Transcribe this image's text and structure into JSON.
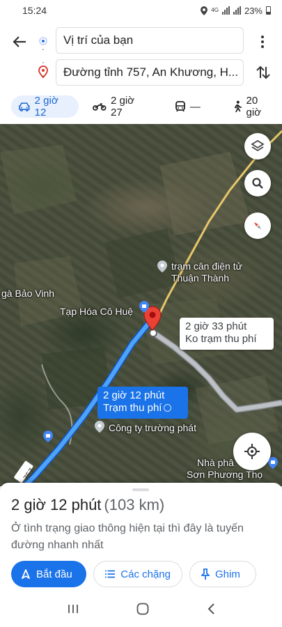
{
  "status_bar": {
    "time": "15:24",
    "network": "4G",
    "battery": "23%"
  },
  "route": {
    "origin": "Vị trí của bạn",
    "destination": "Đường tỉnh 757, An Khương, H..."
  },
  "modes": [
    {
      "name": "car",
      "label": "2 giờ 12",
      "active": true
    },
    {
      "name": "motorbike",
      "label": "2 giờ 27",
      "active": false
    },
    {
      "name": "transit",
      "label": "—",
      "active": false
    },
    {
      "name": "walk",
      "label": "20 giờ",
      "active": false
    }
  ],
  "map": {
    "labels": {
      "place_1": "trạm cân điện tử",
      "place_1b": "Thuận Thành",
      "place_2": "gà Bảo Vinh",
      "place_3": "Tạp Hóa Cô Huệ",
      "place_4": "Công ty trường phát",
      "place_5": "Nhà phâ",
      "place_6": "Sơn Phương Thọ",
      "road": "757"
    },
    "selected_route": {
      "time": "2 giờ 12 phút",
      "note": "Trạm thu phí"
    },
    "alt_route": {
      "time": "2 giờ 33 phút",
      "note": "Ko trạm thu phí"
    },
    "colors": {
      "selected": "#1a73e8",
      "alt": "#bdc1c6",
      "destination": "#ea4335"
    }
  },
  "summary": {
    "duration": "2 giờ 12 phút",
    "distance": "(103 km)",
    "description": "Ở tình trạng giao thông hiện tại thì đây là tuyến đường nhanh nhất",
    "buttons": {
      "start": "Bắt đầu",
      "stops": "Các chặng",
      "pin": "Ghim"
    }
  }
}
